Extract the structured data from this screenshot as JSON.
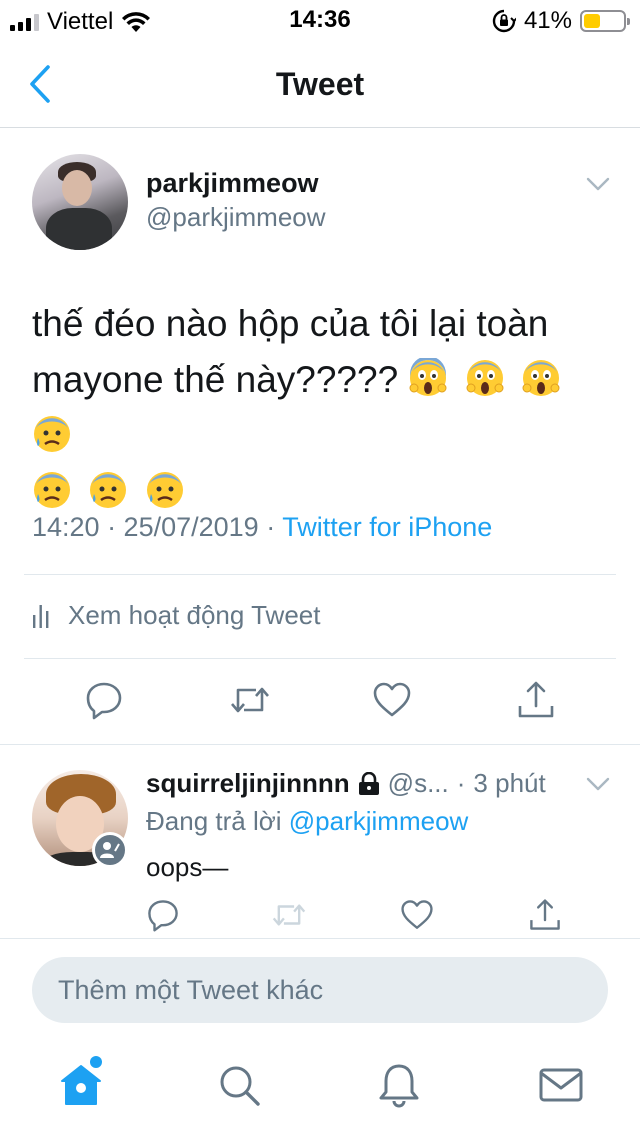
{
  "status_bar": {
    "carrier": "Viettel",
    "time": "14:36",
    "battery_percent": "41%",
    "battery_level": 0.41,
    "battery_color": "#ffcc00"
  },
  "nav": {
    "title": "Tweet",
    "back_icon": "chevron-left-icon"
  },
  "tweet": {
    "display_name": "parkjimmeow",
    "handle": "@parkjimmeow",
    "text": "thế đéo nào hộp của tôi lại toàn mayone thế này?????",
    "emojis": [
      "face-screaming-in-fear",
      "face-screaming-in-fear",
      "face-screaming-in-fear",
      "anxious-face-with-sweat",
      "anxious-face-with-sweat",
      "anxious-face-with-sweat",
      "anxious-face-with-sweat"
    ],
    "timestamp": "14:20 · 25/07/2019 · ",
    "source": "Twitter for iPhone",
    "activity_label": "Xem hoạt động Tweet"
  },
  "reply": {
    "display_name": "squirreljinjinnnn",
    "handle": "@s...",
    "separator": "·",
    "time": "3 phút",
    "replying_prefix": "Đang trả lời ",
    "replying_mention": "@parkjimmeow",
    "text": "oops—"
  },
  "compose": {
    "placeholder": "Thêm một Tweet khác"
  },
  "tab_bar": {
    "items": [
      "home-icon",
      "search-icon",
      "notifications-icon",
      "messages-icon"
    ]
  },
  "colors": {
    "accent": "#1da1f2",
    "secondary_text": "#657786",
    "divider": "#e1e8ed"
  }
}
